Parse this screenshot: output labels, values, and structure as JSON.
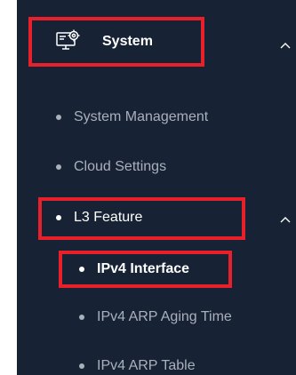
{
  "sidebar": {
    "section": {
      "label": "System",
      "icon": "settings-monitor-icon",
      "expanded": true
    },
    "items": [
      {
        "label": "System Management"
      },
      {
        "label": "Cloud Settings"
      },
      {
        "label": "L3 Feature",
        "expanded": true
      }
    ],
    "subitems": [
      {
        "label": "IPv4 Interface",
        "active": true
      },
      {
        "label": "IPv4 ARP Aging Time"
      },
      {
        "label": "IPv4 ARP Table"
      }
    ]
  },
  "colors": {
    "background": "#172334",
    "text_dim": "#a9b0bb",
    "text_active": "#ffffff",
    "highlight": "#e8202a"
  }
}
